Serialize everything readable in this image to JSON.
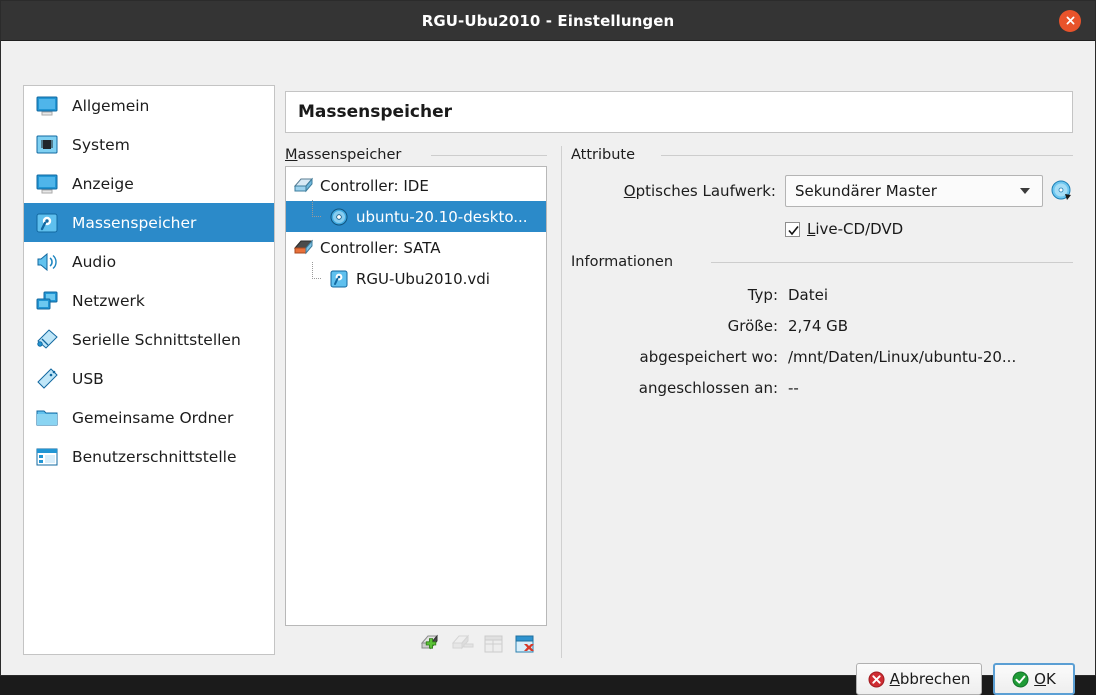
{
  "window": {
    "title": "RGU-Ubu2010 - Einstellungen",
    "close_icon": "close-icon",
    "accent_selection": "#2b8ac9",
    "titlebar_bg": "#343434",
    "close_bg": "#e8532b"
  },
  "sidebar": {
    "items": [
      {
        "label": "Allgemein",
        "icon": "monitor-icon",
        "selected": false
      },
      {
        "label": "System",
        "icon": "chip-icon",
        "selected": false
      },
      {
        "label": "Anzeige",
        "icon": "monitor-icon",
        "selected": false
      },
      {
        "label": "Massenspeicher",
        "icon": "harddisk-icon",
        "selected": true
      },
      {
        "label": "Audio",
        "icon": "speaker-icon",
        "selected": false
      },
      {
        "label": "Netzwerk",
        "icon": "network-icon",
        "selected": false
      },
      {
        "label": "Serielle Schnittstellen",
        "icon": "serial-port-icon",
        "selected": false
      },
      {
        "label": "USB",
        "icon": "usb-icon",
        "selected": false
      },
      {
        "label": "Gemeinsame Ordner",
        "icon": "folder-icon",
        "selected": false
      },
      {
        "label": "Benutzerschnittstelle",
        "icon": "window-icon",
        "selected": false
      }
    ]
  },
  "page": {
    "title": "Massenspeicher"
  },
  "storage": {
    "group_label_prefix": "M",
    "group_label_rest": "assenspeicher",
    "tree": [
      {
        "label": "Controller: IDE",
        "icon": "ide-controller-icon",
        "level": 0,
        "selected": false
      },
      {
        "label": "ubuntu-20.10-deskto...",
        "icon": "cd-disc-icon",
        "level": 1,
        "selected": true
      },
      {
        "label": "Controller: SATA",
        "icon": "sata-controller-icon",
        "level": 0,
        "selected": false
      },
      {
        "label": "RGU-Ubu2010.vdi",
        "icon": "harddisk-icon",
        "level": 1,
        "selected": false
      }
    ],
    "toolbar": [
      {
        "name": "add-controller-button",
        "icon": "add-controller-icon",
        "enabled": true
      },
      {
        "name": "remove-controller-button",
        "icon": "remove-controller-icon",
        "enabled": false
      },
      {
        "name": "add-attachment-button",
        "icon": "add-attachment-icon",
        "enabled": false
      },
      {
        "name": "remove-attachment-button",
        "icon": "remove-attachment-icon",
        "enabled": true
      }
    ]
  },
  "attributes": {
    "group_label": "Attribute",
    "drive_label_prefix": "O",
    "drive_label_rest": "ptisches Laufwerk:",
    "drive_value": "Sekundärer Master",
    "drive_browse_icon": "cd-browse-icon",
    "livecd_prefix": "L",
    "livecd_rest": "ive-CD/DVD",
    "livecd_checked": true
  },
  "information": {
    "group_label": "Informationen",
    "rows": [
      {
        "label": "Typ:",
        "value": "Datei"
      },
      {
        "label": "Größe:",
        "value": "2,74 GB"
      },
      {
        "label": "abgespeichert wo:",
        "value": "/mnt/Daten/Linux/ubuntu-20..."
      },
      {
        "label": "angeschlossen an:",
        "value": "--"
      }
    ]
  },
  "footer": {
    "cancel_prefix": "",
    "cancel_a": "A",
    "cancel_rest": "bbrechen",
    "cancel_icon": "cancel-icon",
    "ok_o": "O",
    "ok_rest": "K",
    "ok_icon": "ok-icon"
  }
}
